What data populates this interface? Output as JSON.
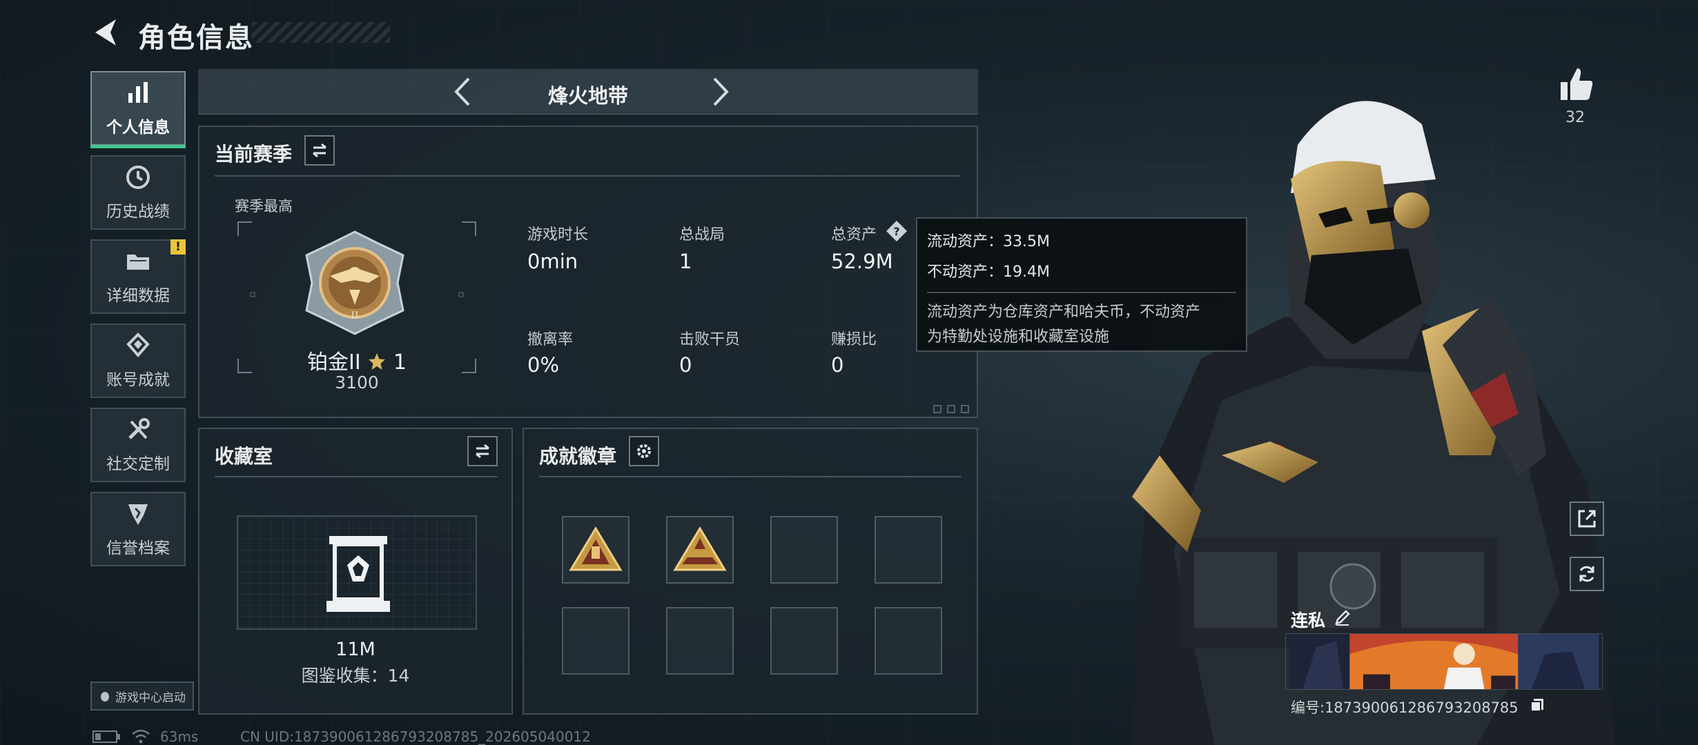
{
  "header": {
    "title": "角色信息"
  },
  "sidebar": {
    "items": [
      {
        "label": "个人信息",
        "icon": "bar-chart-icon",
        "active": true
      },
      {
        "label": "历史战绩",
        "icon": "clock-icon"
      },
      {
        "label": "详细数据",
        "icon": "folder-icon",
        "badge": "!"
      },
      {
        "label": "账号成就",
        "icon": "achievement-icon"
      },
      {
        "label": "社交定制",
        "icon": "tools-icon"
      },
      {
        "label": "信誉档案",
        "icon": "shield-icon"
      }
    ],
    "game_center_label": "游戏中心启动"
  },
  "mode_selector": {
    "title": "烽火地带"
  },
  "season": {
    "title": "当前赛季",
    "best_label": "赛季最高",
    "rank_name": "铂金II",
    "rank_stars": "1",
    "rank_score": "3100",
    "stats": [
      {
        "label": "游戏时长",
        "value": "0min"
      },
      {
        "label": "总战局",
        "value": "1"
      },
      {
        "label": "总资产",
        "value": "52.9M"
      },
      {
        "label": "撤离率",
        "value": "0%"
      },
      {
        "label": "击败干员",
        "value": "0"
      },
      {
        "label": "赚损比",
        "value": "0"
      }
    ]
  },
  "tooltip": {
    "liquid": "流动资产：33.5M",
    "fixed": "不动资产：19.4M",
    "note_line1": "流动资产为仓库资产和哈夫币，不动资产",
    "note_line2": "为特勤处设施和收藏室设施"
  },
  "collection": {
    "title": "收藏室",
    "value": "11M",
    "count": "图鉴收集：14"
  },
  "achievements": {
    "title": "成就徽章",
    "slots": [
      {
        "icon": "badge-triangle-icon"
      },
      {
        "icon": "badge-triangle-icon"
      },
      {
        "icon": ""
      },
      {
        "icon": ""
      },
      {
        "icon": ""
      },
      {
        "icon": ""
      },
      {
        "icon": ""
      },
      {
        "icon": ""
      }
    ]
  },
  "profile": {
    "likes": "32",
    "name": "连私",
    "id": "编号:187390061286793208785"
  },
  "footer": {
    "ping": "63ms",
    "uid": "CN UID:187390061286793208785_202605040012"
  },
  "colors": {
    "accent": "#3fc58d",
    "warning": "#e8c53a",
    "gold": "#c59a42"
  }
}
